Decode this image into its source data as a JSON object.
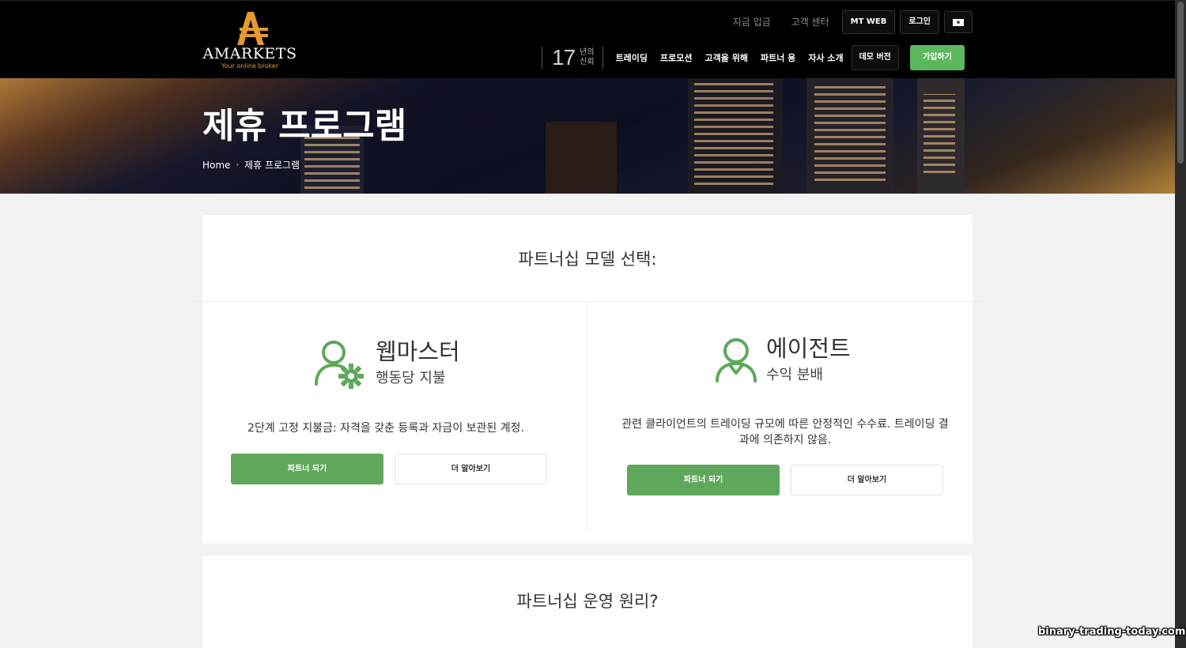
{
  "header": {
    "logo": {
      "wordmark": "AMARKETS",
      "tagline": "Your online broker"
    },
    "top_links": {
      "deposit": "지금 입금",
      "support": "고객 센터",
      "mt_web": "MT WEB",
      "login": "로그인"
    },
    "trust": {
      "years": "17",
      "text_line1": "년의",
      "text_line2": "신뢰"
    },
    "nav": {
      "items": [
        "트레이딩",
        "프로모션",
        "고객을 위해",
        "파트너 용",
        "자사 소개"
      ],
      "demo": "데모 버전",
      "join": "가입하기"
    },
    "colors": {
      "accent": "#5cb85c",
      "logo_orange": "#e49a2d"
    }
  },
  "hero": {
    "title": "제휴 프로그램",
    "breadcrumb": [
      "Home",
      "제휴 프로그램"
    ]
  },
  "partnership": {
    "heading": "파트너십 모델 선택:",
    "models": [
      {
        "icon": "webmaster-user-gear-icon",
        "title": "웹마스터",
        "subtitle": "행동당 지불",
        "description": "2단계 고정 지불금: 자격을 갖춘 등록과 자금이 보관된 계정.",
        "primary": "파트너 되기",
        "secondary": "더 알아보기"
      },
      {
        "icon": "agent-user-icon",
        "title": "에이전트",
        "subtitle": "수익 분배",
        "description": "관련 클라이언트의 트레이딩 규모에 따른 안정적인 수수료. 트레이딩 결과에 의존하지 않음.",
        "primary": "파트너 되기",
        "secondary": "더 알아보기"
      }
    ]
  },
  "how_it_works": {
    "heading": "파트너십 운영 원리?"
  },
  "watermark": "binary-trading-today.com"
}
